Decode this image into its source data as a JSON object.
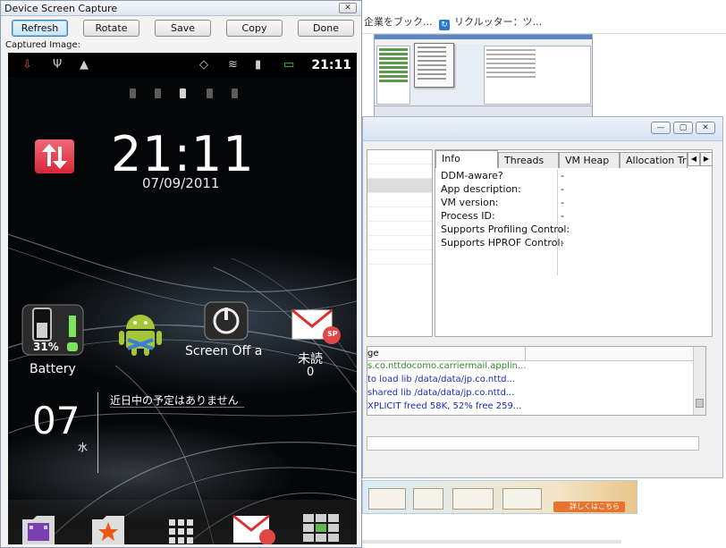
{
  "dialog": {
    "title": "Device Screen Capture",
    "close_glyph": "✕",
    "buttons": {
      "refresh": "Refresh",
      "rotate": "Rotate",
      "save": "Save",
      "copy": "Copy",
      "done": "Done"
    },
    "captured_label": "Captured Image:"
  },
  "phone": {
    "status_clock": "21:11",
    "clock": "21:11",
    "date": "07/09/2011",
    "shortcuts": {
      "battery_percent": "31%",
      "battery_label": "Battery",
      "screen_off_label": "Screen Off a",
      "unread_label": "未読",
      "unread_count": "0"
    },
    "calendar": {
      "day": "07",
      "weekday": "水",
      "message": "近日中の予定はありません"
    },
    "mail_badge": "SP"
  },
  "browser": {
    "bookmarks": [
      {
        "label": "企業をブック..."
      },
      {
        "label": "リクルッター：ツ..."
      }
    ]
  },
  "ddms": {
    "window_buttons": {
      "minimize": "—",
      "maximize": "▢",
      "close": "✕"
    },
    "tabs": [
      {
        "label": "Info",
        "active": true
      },
      {
        "label": "Threads",
        "active": false
      },
      {
        "label": "VM Heap",
        "active": false
      },
      {
        "label": "Allocation Trac",
        "active": false
      }
    ],
    "tab_nav": {
      "left": "◀",
      "right": "▶"
    },
    "info_rows": [
      {
        "key": "DDM-aware?",
        "value": "-"
      },
      {
        "key": "App description:",
        "value": "-"
      },
      {
        "key": "VM version:",
        "value": "-"
      },
      {
        "key": "Process ID:",
        "value": "-"
      },
      {
        "key": "Supports Profiling Control:",
        "value": "-"
      },
      {
        "key": "Supports HPROF Control:",
        "value": "-"
      }
    ],
    "log": {
      "column_header": "ge",
      "lines": [
        {
          "text": "s.co.nttdocomo.carriermail.applin...",
          "color": "#2e8b22"
        },
        {
          "text": "to load lib /data/data/jp.co.nttd...",
          "color": "#1a2bb8"
        },
        {
          "text": "shared lib /data/data/jp.co.nttd...",
          "color": "#1a2bb8"
        },
        {
          "text": "XPLICIT freed 58K, 52% free 259...",
          "color": "#1a2bb8"
        }
      ]
    }
  },
  "banner": {
    "cta": "詳しくはこちら"
  }
}
